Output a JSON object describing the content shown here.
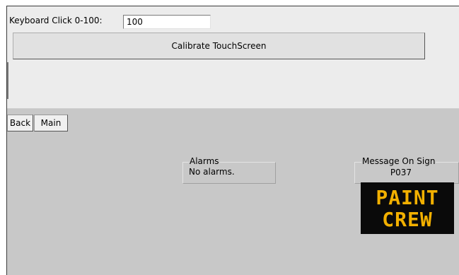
{
  "settings": {
    "keyboard_click_label": "Keyboard Click 0-100:",
    "keyboard_click_value": "100",
    "calibrate_label": "Calibrate TouchScreen"
  },
  "nav": {
    "back_label": "Back",
    "main_label": "Main"
  },
  "alarms": {
    "title": "Alarms",
    "status": "No alarms."
  },
  "sign": {
    "title": "Message On Sign",
    "code": "P037",
    "lines": [
      "PAINT",
      "CREW"
    ],
    "text_color": "#f2b000",
    "background_color": "#0a0a0a"
  },
  "colors": {
    "panel_background": "#ececec",
    "screen_background": "#c8c8c8"
  }
}
